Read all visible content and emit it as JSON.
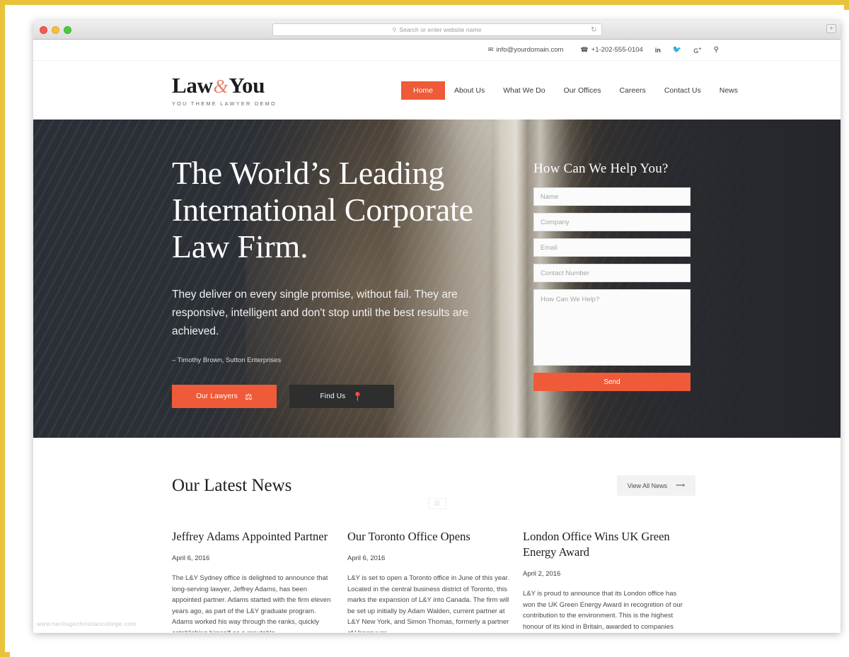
{
  "browser": {
    "url_placeholder": "Search or enter website name",
    "search_icon": "search-icon",
    "reload_icon": "reload-icon",
    "newtab_icon": "new-tab-icon",
    "traffic_lights": [
      "close",
      "minimize",
      "maximize"
    ]
  },
  "topbar": {
    "email": "info@yourdomain.com",
    "phone": "+1-202-555-0104",
    "email_icon": "envelope-icon",
    "phone_icon": "phone-icon",
    "social": [
      {
        "name": "linkedin-icon",
        "glyph": "in"
      },
      {
        "name": "twitter-icon",
        "glyph": "🐦"
      },
      {
        "name": "google-plus-icon",
        "glyph": "G+"
      },
      {
        "name": "search-icon",
        "glyph": "⌕"
      }
    ]
  },
  "header": {
    "logo_left": "Law",
    "logo_amp": "&",
    "logo_right": "You",
    "logo_tagline": "YOU THEME LAWYER DEMO",
    "nav": [
      {
        "label": "Home",
        "active": true
      },
      {
        "label": "About Us",
        "active": false
      },
      {
        "label": "What We Do",
        "active": false
      },
      {
        "label": "Our Offices",
        "active": false
      },
      {
        "label": "Careers",
        "active": false
      },
      {
        "label": "Contact Us",
        "active": false
      },
      {
        "label": "News",
        "active": false
      }
    ]
  },
  "hero": {
    "title": "The World’s Leading International Corporate Law Firm.",
    "subtitle": "They deliver on every single promise, without fail. They are responsive, intelligent and don't stop until the best results are achieved.",
    "attribution": "– Timothy Brown, Sutton Enterprises",
    "btn_lawyers": "Our Lawyers",
    "btn_lawyers_icon": "scales-of-justice-icon",
    "btn_find": "Find Us",
    "btn_find_icon": "map-pin-icon",
    "form": {
      "title": "How Can We Help You?",
      "name_placeholder": "Name",
      "company_placeholder": "Company",
      "email_placeholder": "Email",
      "contact_placeholder": "Contact Number",
      "message_placeholder": "How Can We Help?",
      "send_label": "Send"
    }
  },
  "news": {
    "section_title": "Our Latest News",
    "view_all_label": "View All News",
    "view_all_icon": "arrow-right-icon",
    "separator_icon": "grid-icon",
    "items": [
      {
        "title": "Jeffrey Adams Appointed Partner",
        "date": "April 6, 2016",
        "body": "The L&Y Sydney office is delighted to announce that long-serving lawyer, Jeffrey Adams, has been appointed partner. Adams started with the firm eleven years ago, as part of the L&Y graduate program. Adams worked his way through the ranks, quickly establishing himself as a reputable"
      },
      {
        "title": "Our Toronto Office Opens",
        "date": "April 6, 2016",
        "body": "L&Y is set to open a Toronto office in June of this year. Located in the central business district of Toronto, this marks the expansion of L&Y into Canada. The firm will be set up initially by Adam Walden, current partner at L&Y New York, and Simon Thomas, formerly a partner of Vancouver-"
      },
      {
        "title": "London Office Wins UK Green Energy Award",
        "date": "April 2, 2016",
        "body": "L&Y is proud to announce that its London office has won the UK Green Energy Award in recognition of our contribution to the environment. This is the highest honour of its kind in Britain, awarded to companies who are working hard to reduce their"
      }
    ]
  },
  "watermark": "www.heritagechristiancollege.com",
  "colors": {
    "accent": "#ef5a38",
    "dark_button": "#2e2e2e",
    "frame": "#e8c33a",
    "amp": "#e3816a"
  }
}
